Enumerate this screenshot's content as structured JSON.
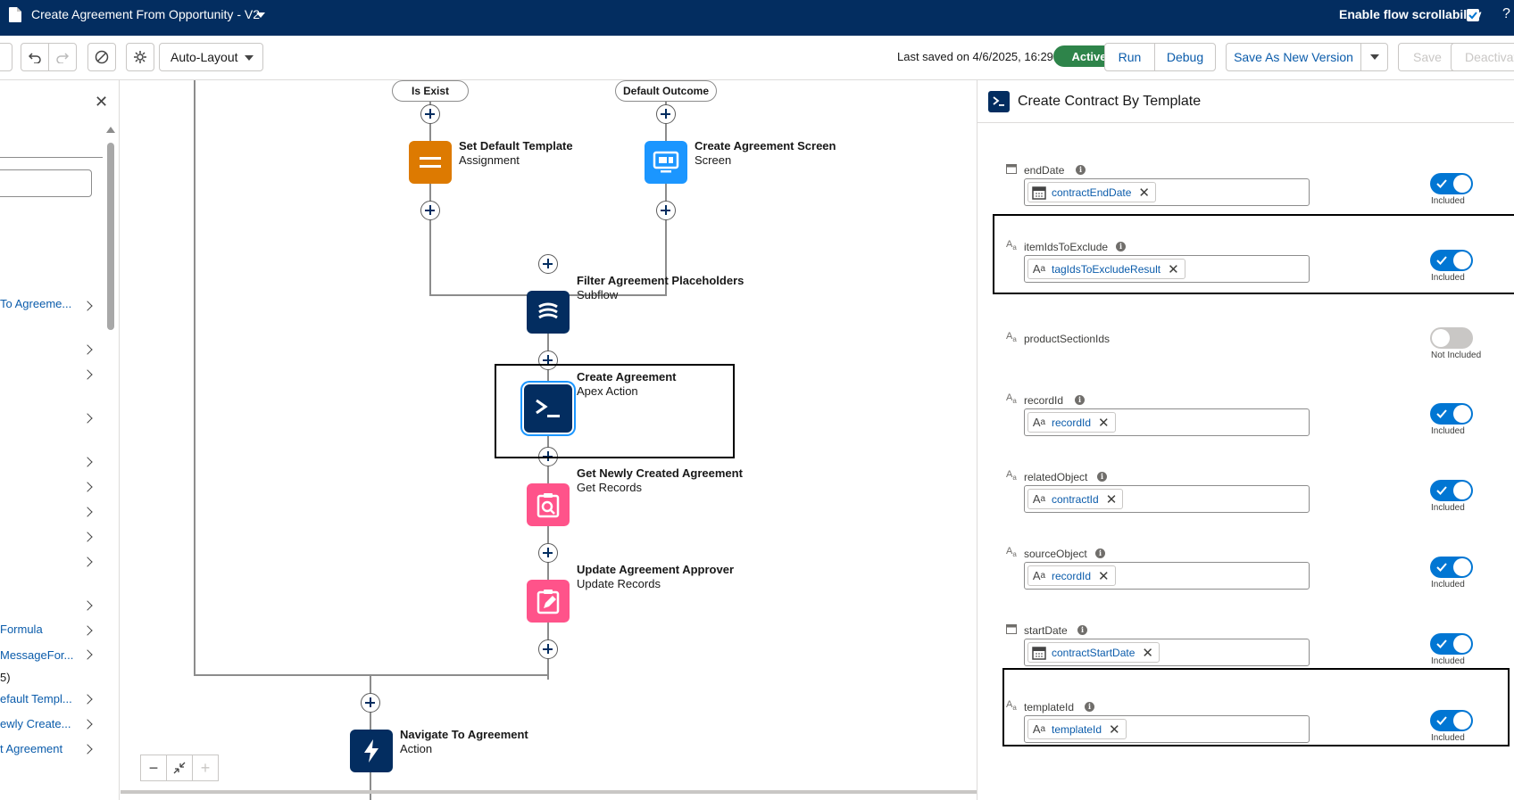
{
  "topbar": {
    "title": "Create Agreement From Opportunity - V2",
    "scrollability_label": "Enable flow scrollability",
    "scrollability_checked": true,
    "help": "?"
  },
  "toolbar": {
    "layout_select": "Auto-Layout",
    "last_saved": "Last saved on 4/6/2025, 16:29",
    "status_badge": "Active",
    "run_label": "Run",
    "debug_label": "Debug",
    "save_new_version_label": "Save As New Version",
    "save_label": "Save",
    "deactivate_label": "Deactivate"
  },
  "left_panel": {
    "items": [
      {
        "label": "To Agreeme..."
      },
      {
        "label": "Formula"
      },
      {
        "label": "MessageFor..."
      },
      {
        "label": "5)"
      },
      {
        "label": "efault Templ..."
      },
      {
        "label": "ewly Create..."
      },
      {
        "label": "t Agreement"
      }
    ]
  },
  "canvas": {
    "outcomes": [
      {
        "label": "Is Exist"
      },
      {
        "label": "Default Outcome"
      }
    ],
    "nodes": [
      {
        "title": "Set Default Template",
        "subtitle": "Assignment",
        "color": "#dd7a01",
        "icon": "assignment-icon"
      },
      {
        "title": "Create Agreement Screen",
        "subtitle": "Screen",
        "color": "#1b96ff",
        "icon": "screen-icon"
      },
      {
        "title": "Filter Agreement Placeholders",
        "subtitle": "Subflow",
        "color": "#032d60",
        "icon": "subflow-icon"
      },
      {
        "title": "Create Agreement",
        "subtitle": "Apex Action",
        "color": "#032d60",
        "icon": "apex-action-icon"
      },
      {
        "title": "Get Newly Created Agreement",
        "subtitle": "Get Records",
        "color": "#ff538a",
        "icon": "get-records-icon"
      },
      {
        "title": "Update Agreement Approver",
        "subtitle": "Update Records",
        "color": "#ff538a",
        "icon": "update-records-icon"
      },
      {
        "title": "Navigate To Agreement",
        "subtitle": "Action",
        "color": "#032d60",
        "icon": "action-icon"
      }
    ]
  },
  "right_panel": {
    "title": "Create Contract By Template",
    "params": [
      {
        "name": "endDate",
        "type": "date",
        "value": "contractEndDate",
        "included": true,
        "status": "Included"
      },
      {
        "name": "itemIdsToExclude",
        "type": "text",
        "value": "tagIdsToExcludeResult",
        "included": true,
        "status": "Included"
      },
      {
        "name": "productSectionIds",
        "type": "text",
        "value": "",
        "included": false,
        "status": "Not Included"
      },
      {
        "name": "recordId",
        "type": "text",
        "value": "recordId",
        "included": true,
        "status": "Included"
      },
      {
        "name": "relatedObject",
        "type": "text",
        "value": "contractId",
        "included": true,
        "status": "Included"
      },
      {
        "name": "sourceObject",
        "type": "text",
        "value": "recordId",
        "included": true,
        "status": "Included"
      },
      {
        "name": "startDate",
        "type": "date",
        "value": "contractStartDate",
        "included": true,
        "status": "Included"
      },
      {
        "name": "templateId",
        "type": "text",
        "value": "templateId",
        "included": true,
        "status": "Included"
      }
    ]
  },
  "colors": {
    "brand_navy": "#032d60",
    "accent_blue": "#0176d3",
    "active_green": "#2e844a"
  }
}
